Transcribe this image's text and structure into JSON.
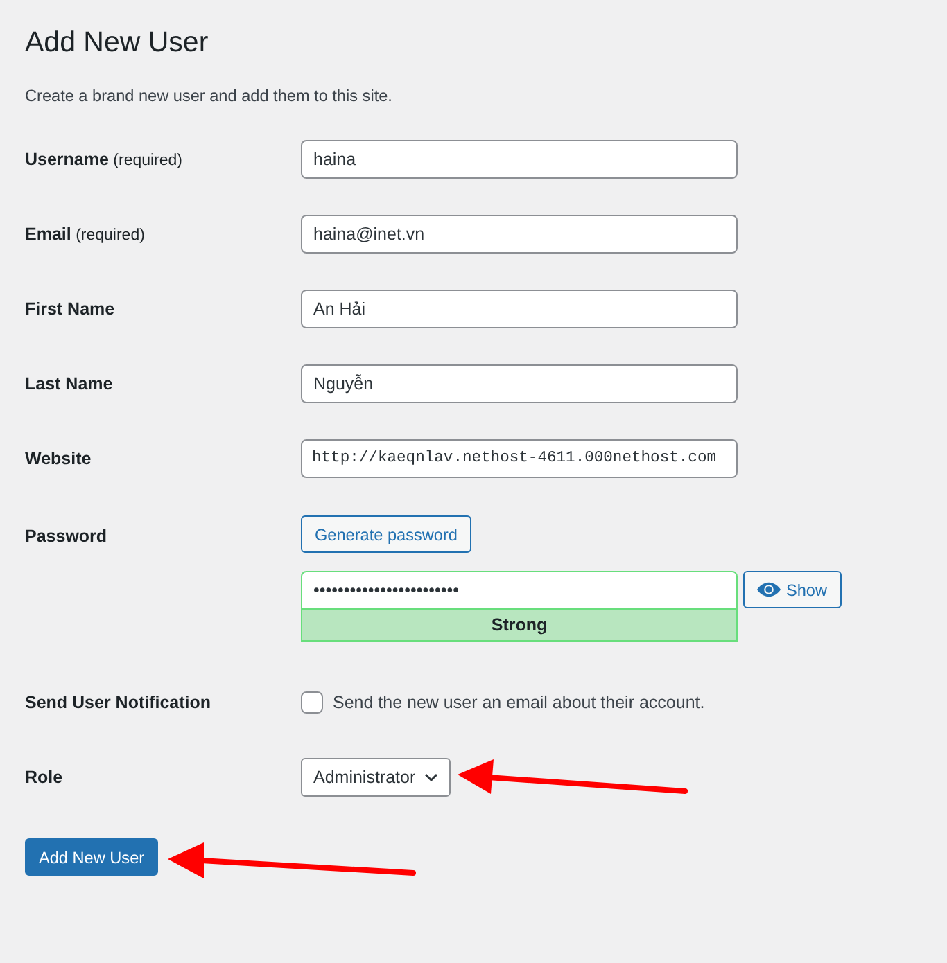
{
  "page": {
    "title": "Add New User",
    "description": "Create a brand new user and add them to this site."
  },
  "fields": [
    {
      "kind": "text",
      "label": "Username",
      "note": "(required)",
      "value": "haina"
    },
    {
      "kind": "text",
      "label": "Email",
      "note": "(required)",
      "value": "haina@inet.vn"
    },
    {
      "kind": "text",
      "label": "First Name",
      "value": "An Hải"
    },
    {
      "kind": "text",
      "label": "Last Name",
      "value": "Nguyễn"
    },
    {
      "kind": "url",
      "label": "Website",
      "value": "http://kaeqnlav.nethost-4611.000nethost.com"
    }
  ],
  "password": {
    "label": "Password",
    "generate_button": "Generate password",
    "value": "••••••••••••••••••••••••",
    "strength": "Strong",
    "show_button": "Show"
  },
  "notification": {
    "label": "Send User Notification",
    "checkbox_label": "Send the new user an email about their account.",
    "checked": false
  },
  "role": {
    "label": "Role",
    "value": "Administrator"
  },
  "submit_button": "Add New User"
}
